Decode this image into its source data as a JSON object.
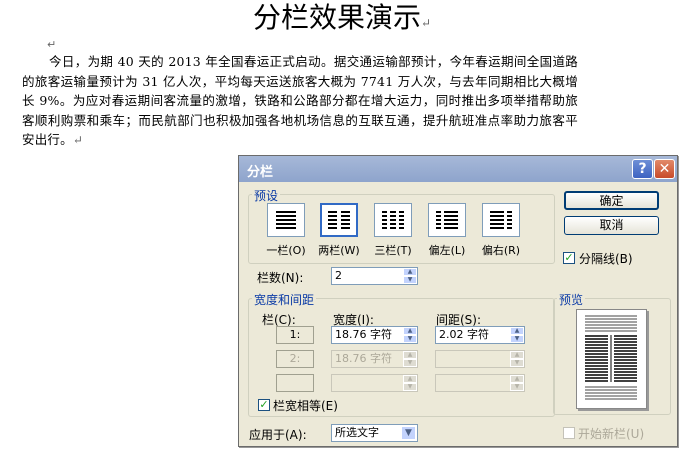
{
  "document": {
    "title": "分栏效果演示",
    "pilcrow": "↵",
    "paragraph": "今日，为期 40 天的 2013 年全国春运正式启动。据交通运输部预计，今年春运期间全国道路的旅客运输量预计为 31 亿人次，平均每天运送旅客大概为 7741 万人次，与去年同期相比大概增长 9%。为应对春运期间客流量的激增，铁路和公路部分都在增大运力，同时推出多项举措帮助旅客顺利购票和乘车；而民航部门也积极加强各地机场信息的互联互通，提升航班准点率助力旅客平安出行。"
  },
  "dialog": {
    "title": "分栏",
    "help_icon": "?",
    "close_icon": "✕",
    "presets": {
      "group_label": "预设",
      "items": [
        {
          "label": "一栏(O)",
          "icon": "one-column-icon"
        },
        {
          "label": "两栏(W)",
          "icon": "two-columns-icon",
          "selected": true
        },
        {
          "label": "三栏(T)",
          "icon": "three-columns-icon"
        },
        {
          "label": "偏左(L)",
          "icon": "left-column-icon"
        },
        {
          "label": "偏右(R)",
          "icon": "right-column-icon"
        }
      ]
    },
    "ok_label": "确定",
    "cancel_label": "取消",
    "separator_line_label": "分隔线(B)",
    "separator_line_checked": true,
    "num_columns_label": "栏数(N):",
    "num_columns_value": "2",
    "width_spacing": {
      "group_label": "宽度和间距",
      "col_header": "栏(C):",
      "width_header": "宽度(I):",
      "spacing_header": "间距(S):",
      "rows": [
        {
          "col": "1:",
          "width": "18.76 字符",
          "spacing": "2.02 字符"
        },
        {
          "col": "2:",
          "width": "18.76 字符",
          "spacing": ""
        },
        {
          "col": "",
          "width": "",
          "spacing": ""
        }
      ]
    },
    "equal_width_label": "栏宽相等(E)",
    "equal_width_checked": true,
    "apply_to_label": "应用于(A):",
    "apply_to_value": "所选文字",
    "preview_label": "预览",
    "start_new_column_label": "开始新栏(U)",
    "start_new_column_checked": false,
    "colors": {
      "title_text": "#ffffff",
      "group_label": "#0b3ba6",
      "disabled": "#aca899"
    }
  }
}
